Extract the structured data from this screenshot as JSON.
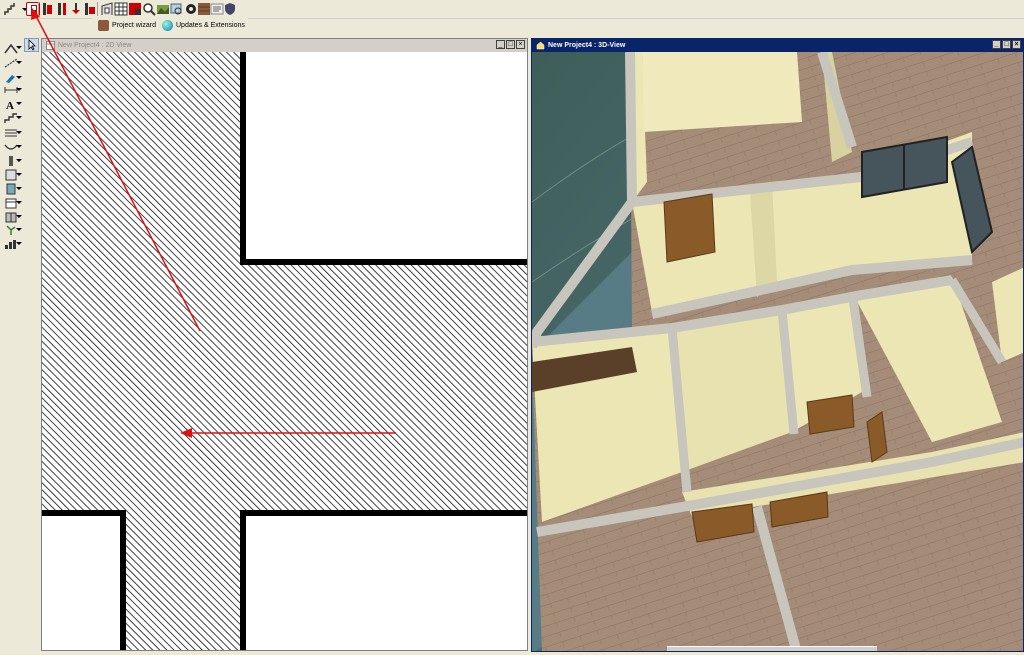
{
  "links": {
    "project_wizard": "Project wizard",
    "updates_extensions": "Updates & Extensions"
  },
  "windows": {
    "plan": {
      "title": "New Project4 : 2D View"
    },
    "view3d": {
      "title": "New Project4 : 3D-View"
    }
  },
  "colors": {
    "annotation_arrow": "#e01010",
    "wall": "#000000",
    "hatch": "#000000",
    "title_active": "#0a246a",
    "title_inactive": "#d4d0c8",
    "floor": "#a08874",
    "wall_3d": "#ece6b4",
    "ground": "#4a6468"
  },
  "icons": {
    "toolbar": [
      "stairs-icon",
      "window-tool-icon",
      "door-icon",
      "column-icon",
      "wall-opening-icon",
      "skylight-icon",
      "grid-icon",
      "texture-icon",
      "photo-icon",
      "magnify-icon",
      "gear-icon",
      "material-icon",
      "render-icon",
      "shield-icon"
    ],
    "left": [
      "roof-icon",
      "select-icon",
      "line-icon",
      "pen-icon",
      "dimension-icon",
      "text-icon",
      "stairs-icon",
      "hatch-icon",
      "curve-icon",
      "column-icon",
      "wall-icon",
      "door-icon",
      "window-icon",
      "cabinet-icon",
      "plant-icon",
      "chart-icon"
    ]
  }
}
